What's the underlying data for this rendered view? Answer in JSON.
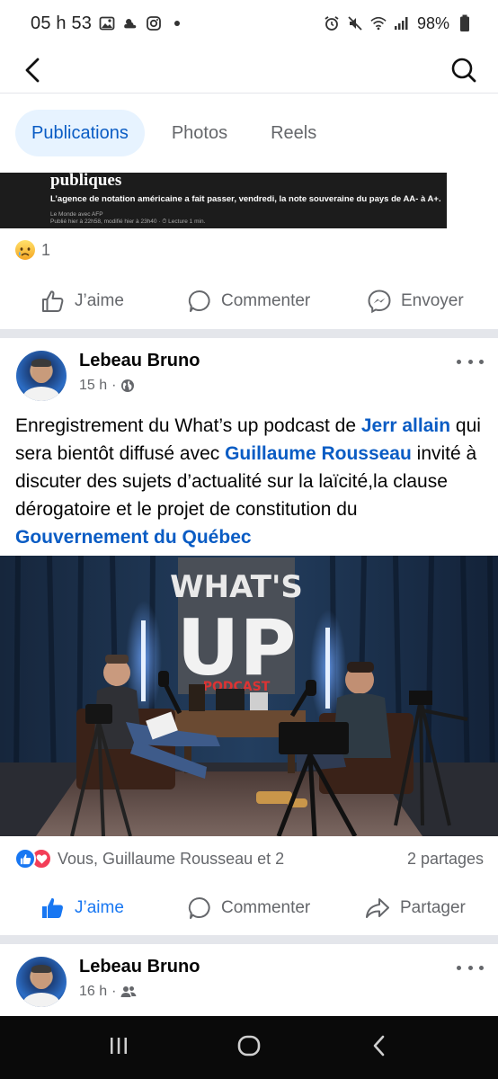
{
  "status_bar": {
    "time": "05 h 53",
    "battery": "98%"
  },
  "tabs": [
    {
      "label": "Publications",
      "active": true
    },
    {
      "label": "Photos",
      "active": false
    },
    {
      "label": "Reels",
      "active": false
    }
  ],
  "prev_post": {
    "image_headline": "publiques",
    "image_sub": "L’agence de notation américaine a fait passer, vendredi, la note souveraine du pays de AA- à A+.",
    "image_source": "Le Monde avec AFP",
    "image_meta": "Publié hier à 22h58, modifié hier à 23h40 · ⏱ Lecture 1 min.",
    "reaction_count": "1",
    "actions": {
      "like": "J’aime",
      "comment": "Commenter",
      "send": "Envoyer"
    }
  },
  "post": {
    "author": "Lebeau Bruno",
    "time": "15 h",
    "text_parts": [
      {
        "t": "Enregistrement du What’s up podcast de ",
        "m": false
      },
      {
        "t": "Jerr allain",
        "m": true
      },
      {
        "t": " qui sera bientôt diffusé avec ",
        "m": false
      },
      {
        "t": "Guillaume Rousseau",
        "m": true
      },
      {
        "t": " invité à discuter des sujets d’actualité sur la laïcité,la clause dérogatoire et le projet de constitution du ",
        "m": false
      },
      {
        "t": "Gouvernement du Québec",
        "m": true
      }
    ],
    "photo_sign_line1": "WHAT'S",
    "photo_sign_line2": "UP",
    "photo_sign_line3": "PODCAST",
    "reactions_text": "Vous, Guillaume Rousseau et 2",
    "shares": "2 partages",
    "actions": {
      "like": "J’aime",
      "comment": "Commenter",
      "share": "Partager"
    },
    "liked": true
  },
  "next_post": {
    "author": "Lebeau Bruno",
    "time": "16 h"
  },
  "colors": {
    "accent": "#0a5cc4",
    "like_blue": "#1877f2",
    "love_red": "#f33e58",
    "tab_active_bg": "#e7f3ff",
    "muted": "#65676b"
  }
}
